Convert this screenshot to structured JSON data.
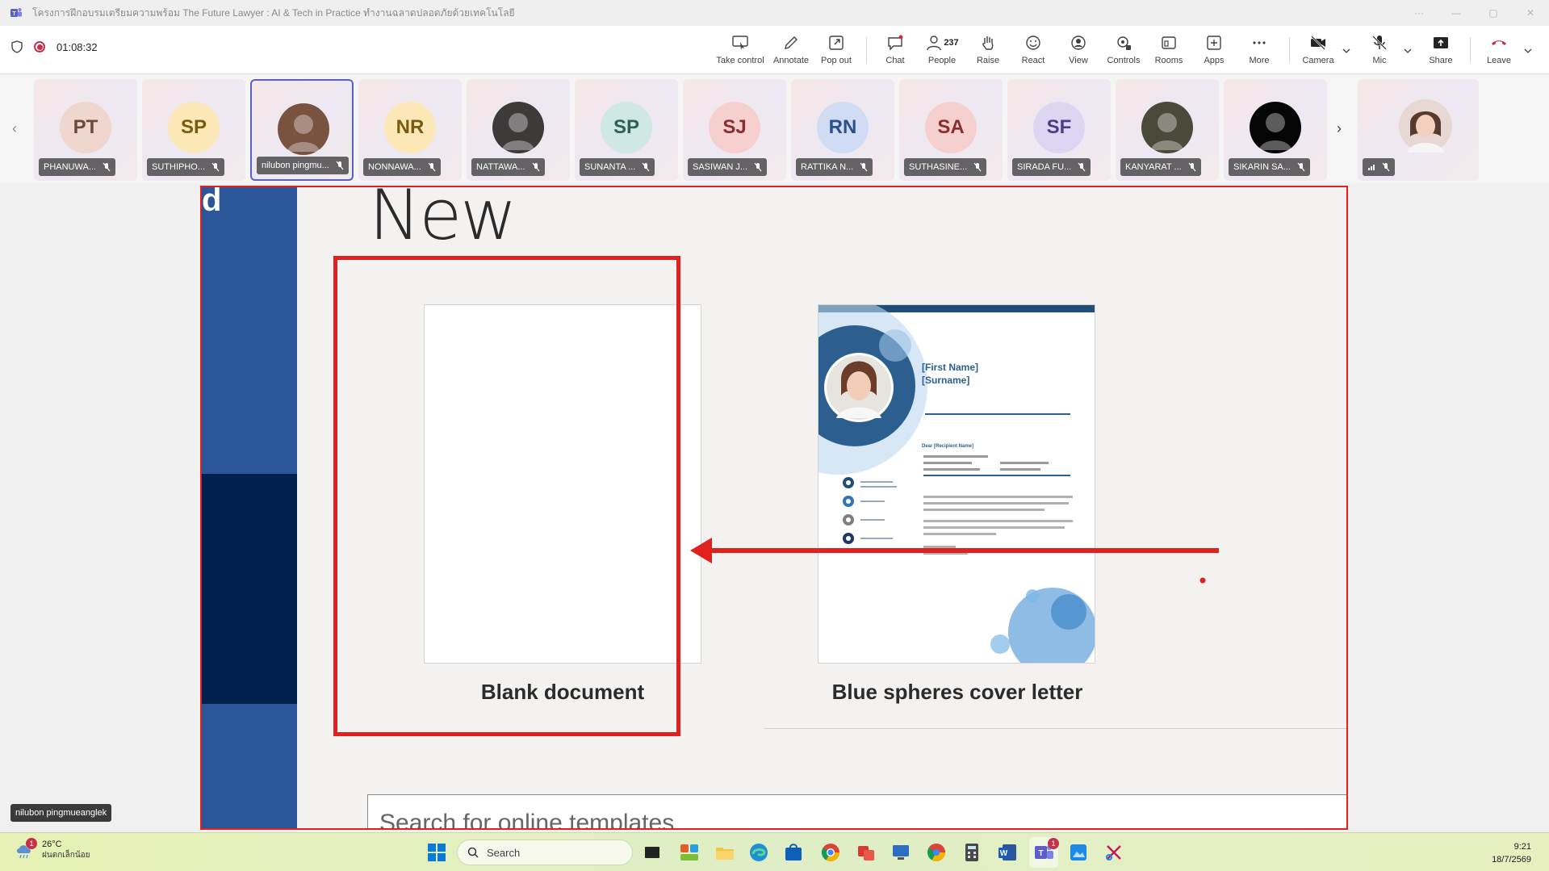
{
  "titlebar": {
    "title": "โครงการฝึกอบรมเตรียมความพร้อม The Future Lawyer : AI & Tech in Practice ทำงานฉลาดปลอดภัยด้วยเทคโนโลยี",
    "more": "···",
    "minimize": "—",
    "maximize": "▢",
    "close": "✕"
  },
  "meeting": {
    "elapsed": "01:08:32",
    "people_count": "237"
  },
  "toolbar": {
    "take_control": "Take control",
    "annotate": "Annotate",
    "pop_out": "Pop out",
    "chat": "Chat",
    "people": "People",
    "raise": "Raise",
    "react": "React",
    "view": "View",
    "controls": "Controls",
    "rooms": "Rooms",
    "apps": "Apps",
    "more": "More",
    "camera": "Camera",
    "mic": "Mic",
    "share": "Share",
    "leave": "Leave"
  },
  "participants": [
    {
      "initials": "PT",
      "name": "PHANUWA...",
      "color": "#6b4a3a",
      "bg": "#efd6cf"
    },
    {
      "initials": "SP",
      "name": "SUTHIPHO...",
      "color": "#7a5a10",
      "bg": "#fbe8b6"
    },
    {
      "initials": "",
      "name": "nilubon pingmu...",
      "color": "#ffffff",
      "bg": "#7a5240"
    },
    {
      "initials": "NR",
      "name": "NONNAWA...",
      "color": "#7a5a10",
      "bg": "#fbe8b6"
    },
    {
      "initials": "",
      "name": "NATTAWA...",
      "color": "#ffffff",
      "bg": "#3d3a3a"
    },
    {
      "initials": "SP",
      "name": "SUNANTA ...",
      "color": "#2f5f5a",
      "bg": "#cfe8e3"
    },
    {
      "initials": "SJ",
      "name": "SASIWAN J...",
      "color": "#8a2d2d",
      "bg": "#f6cfcf"
    },
    {
      "initials": "RN",
      "name": "RATTIKA N...",
      "color": "#2d4f8a",
      "bg": "#cfdcf3"
    },
    {
      "initials": "SA",
      "name": "SUTHASINE...",
      "color": "#8a2d2d",
      "bg": "#f6cfcf"
    },
    {
      "initials": "SF",
      "name": "SIRADA FU...",
      "color": "#4b3d8a",
      "bg": "#ddd6f3"
    },
    {
      "initials": "",
      "name": "KANYARAT ...",
      "color": "#ffffff",
      "bg": "#4a4a3a"
    },
    {
      "initials": "",
      "name": "SIKARIN SA...",
      "color": "#ffffff",
      "bg": "#050505"
    }
  ],
  "self_tile": {
    "name": ""
  },
  "shared_screen": {
    "sidebar_fragment": "d",
    "heading": "New",
    "blank_label": "Blank document",
    "template_label": "Blue spheres cover letter",
    "template_first_name": "[First Name]",
    "template_surname": "[Surname]",
    "template_dear": "Dear [Recipient Name]",
    "search_placeholder": "Search for online templates"
  },
  "presenter_tag": "nilubon pingmueanglek",
  "taskbar": {
    "temperature": "26°C",
    "condition": "ฝนตกเล็กน้อย",
    "search": "Search",
    "time": "9:21",
    "date": "18/7/2569",
    "weather_badge": "1",
    "teams_badge": "1"
  },
  "colors": {
    "accent": "#5b5fc7",
    "highlight_red": "#e0211d",
    "word_blue": "#2b579a",
    "word_dark": "#002050",
    "leave_red": "#c4314b"
  }
}
